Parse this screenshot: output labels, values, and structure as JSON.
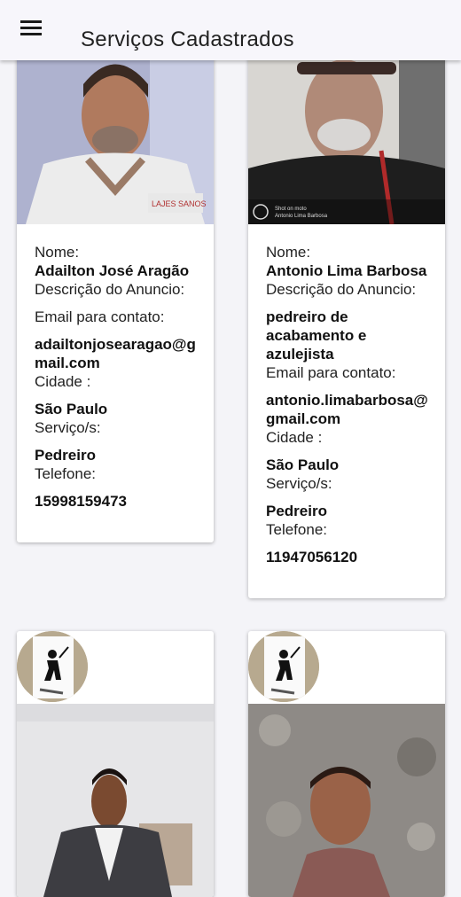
{
  "appbar": {
    "title": "Serviços Cadastrados",
    "menu_icon": "hamburger-menu-icon"
  },
  "labels": {
    "name": "Nome:",
    "description": "Descrição do Anuncio:",
    "email": "Email para contato:",
    "city": "Cidade :",
    "service": "Serviço/s:",
    "phone": "Telefone:"
  },
  "cards": [
    {
      "name": "Adailton José Aragão",
      "description": "",
      "email": "adailtonjosearagao@gmail.com",
      "city": "São Paulo",
      "service": "Pedreiro",
      "phone": "15998159473"
    },
    {
      "name": "Antonio Lima Barbosa",
      "description": "pedreiro de acabamento e azulejista",
      "email": "antonio.limabarbosa@gmail.com",
      "city": "São Paulo",
      "service": "Pedreiro",
      "phone": "11947056120"
    },
    {
      "avatar_icon": "worker-avatar-icon"
    },
    {
      "avatar_icon": "worker-avatar-icon"
    }
  ]
}
